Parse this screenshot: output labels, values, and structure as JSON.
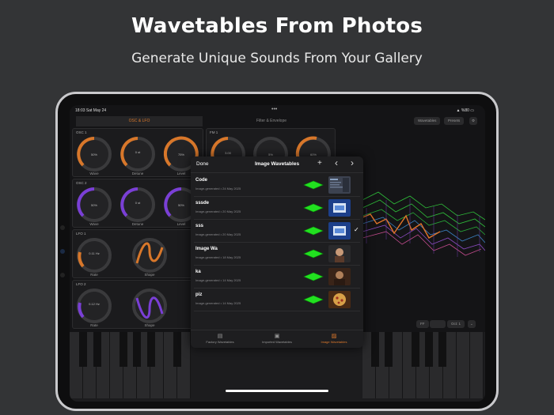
{
  "headline": "Wavetables From Photos",
  "subline": "Generate Unique Sounds From Your Gallery",
  "status": {
    "time": "18:03  Sat May 24",
    "dots": "•••",
    "right": "▲ %80 ▭"
  },
  "tabs": {
    "osc": "OSC & LFO",
    "filter": "Filter & Envelope"
  },
  "top_right": {
    "wavetables": "Wavetables",
    "presets": "Presets",
    "gear": "⚙"
  },
  "panels": {
    "osc1": {
      "title": "OSC 1",
      "knobs": [
        {
          "label": "Wave",
          "value": "50%"
        },
        {
          "label": "Detune",
          "value": "0 st"
        },
        {
          "label": "Level",
          "value": "75%"
        }
      ]
    },
    "osc2": {
      "title": "OSC 2",
      "knobs": [
        {
          "label": "Wave",
          "value": "50%"
        },
        {
          "label": "Detune",
          "value": "0 st"
        },
        {
          "label": "Level",
          "value": "50%"
        }
      ]
    },
    "lfo1": {
      "title": "LFO 1",
      "knobs": [
        {
          "label": "Rate",
          "value": "0.11 Hz"
        },
        {
          "label": "Shape",
          "value": ""
        }
      ]
    },
    "lfo2": {
      "title": "LFO 2",
      "knobs": [
        {
          "label": "Rate",
          "value": "0.12 Hz"
        },
        {
          "label": "Shape",
          "value": ""
        }
      ]
    },
    "fm1": {
      "title": "FM 1",
      "knobs": [
        {
          "label": "",
          "value": "3.00"
        },
        {
          "label": "",
          "value": "5%"
        },
        {
          "label": "",
          "value": "60%"
        }
      ]
    }
  },
  "bottom_right": {
    "ff": "FF",
    "blank": "",
    "oct": "Oct: 1",
    "chevron": "⌄"
  },
  "modal": {
    "done": "Done",
    "title": "Image Wavetables",
    "add": "+",
    "prev": "‹",
    "next": "›",
    "rows": [
      {
        "name": "Code",
        "sub": "Image-generated • 24 May 2025",
        "checked": false
      },
      {
        "name": "sssde",
        "sub": "Image-generated • 20 May 2025",
        "checked": false
      },
      {
        "name": "sss",
        "sub": "Image-generated • 20 May 2025",
        "checked": true
      },
      {
        "name": "Image Wa",
        "sub": "Image-generated • 18 May 2025",
        "checked": false
      },
      {
        "name": "ka",
        "sub": "Image-generated • 14 May 2025",
        "checked": false
      },
      {
        "name": "piz",
        "sub": "Image-generated • 14 May 2025",
        "checked": false
      }
    ],
    "check_glyph": "✓",
    "tabs": [
      {
        "icon": "▤",
        "label": "Factory Wavetables"
      },
      {
        "icon": "▣",
        "label": "Imported Wavetables"
      },
      {
        "icon": "▨",
        "label": "Image Wavetables"
      }
    ]
  },
  "colors": {
    "accent_orange": "#d8772a",
    "accent_purple": "#7a3fd6",
    "wave_green": "#22e020"
  }
}
